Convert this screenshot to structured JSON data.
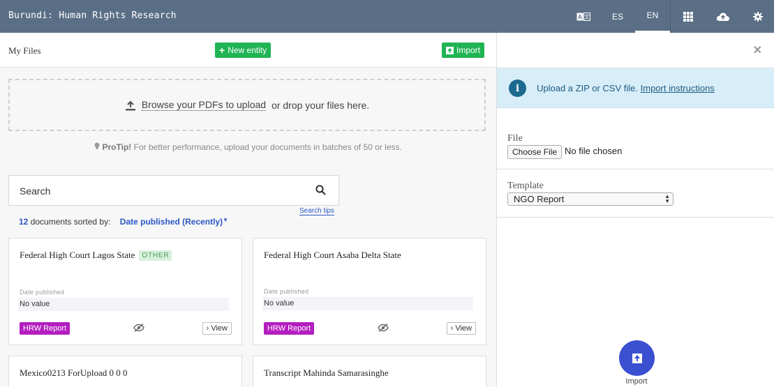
{
  "header": {
    "title": "Burundi: Human Rights Research",
    "languages": [
      "ES",
      "EN"
    ],
    "active_language": "EN",
    "icons": [
      "translate-icon",
      "grid-icon",
      "cloud-upload-icon",
      "gear-icon"
    ]
  },
  "library": {
    "title": "My Files",
    "new_entity_label": "New entity",
    "import_label": "Import",
    "dropzone": {
      "link_text": "Browse your PDFs to upload",
      "rest_text": "or drop your files here."
    },
    "protip": {
      "label": "ProTip!",
      "text": "For better performance, upload your documents in batches of 50 or less."
    },
    "search": {
      "placeholder": "Search",
      "tips": "Search tips"
    },
    "sort": {
      "count": "12",
      "text": "documents sorted by:",
      "value": "Date published (Recently)"
    },
    "cards": [
      {
        "title": "Federal High Court Lagos State",
        "tag": "OTHER",
        "meta_label": "Date published",
        "meta_value": "No value",
        "type": "HRW Report",
        "view": "View"
      },
      {
        "title": "Federal High Court Asaba Delta State",
        "tag": "",
        "meta_label": "Date published",
        "meta_value": "No value",
        "type": "HRW Report",
        "view": "View"
      },
      {
        "title": "Mexico0213 ForUpload 0 0 0"
      },
      {
        "title": "Transcript Mahinda Samarasinghe"
      }
    ]
  },
  "import_panel": {
    "info_text": "Upload a ZIP or CSV file.",
    "info_link": "Import instructions",
    "file_label": "File",
    "file_button": "Choose File",
    "file_status": "No file chosen",
    "template_label": "Template",
    "template_value": "NGO Report",
    "submit_label": "Import"
  },
  "colors": {
    "header_bg": "#5a6f86",
    "green": "#20b454",
    "badge_purple": "#b41ec0",
    "link_blue": "#2b56c4",
    "fab_blue": "#3b4fd1",
    "info_bg": "#d7eef8"
  }
}
